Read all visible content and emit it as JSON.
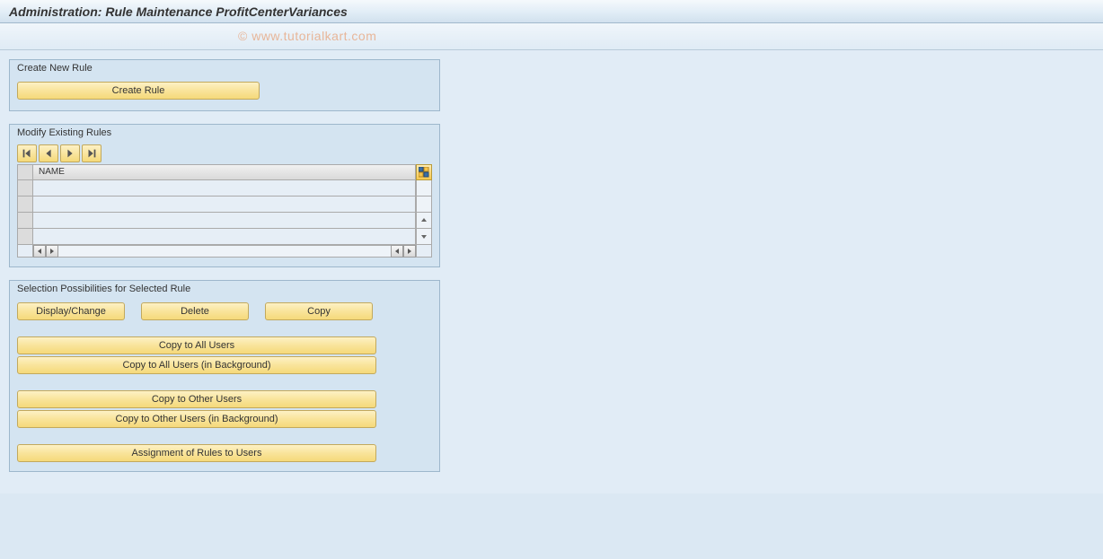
{
  "header": {
    "title": "Administration: Rule Maintenance ProfitCenterVariances",
    "watermark": "© www.tutorialkart.com"
  },
  "createPanel": {
    "title": "Create New Rule",
    "createButton": "Create Rule"
  },
  "modifyPanel": {
    "title": "Modify Existing Rules",
    "iconButtons": [
      "first-page-icon",
      "prev-page-icon",
      "next-page-icon",
      "last-page-icon"
    ],
    "columnHeader": "NAME",
    "rows": [
      "",
      "",
      "",
      ""
    ]
  },
  "selectionPanel": {
    "title": "Selection Possibilities for Selected Rule",
    "displayChange": "Display/Change",
    "delete": "Delete",
    "copy": "Copy",
    "copyAllUsers": "Copy to All Users",
    "copyAllUsersBg": "Copy to All Users (in Background)",
    "copyOtherUsers": "Copy to Other Users",
    "copyOtherUsersBg": "Copy to Other Users (in Background)",
    "assignment": "Assignment of Rules to Users"
  }
}
